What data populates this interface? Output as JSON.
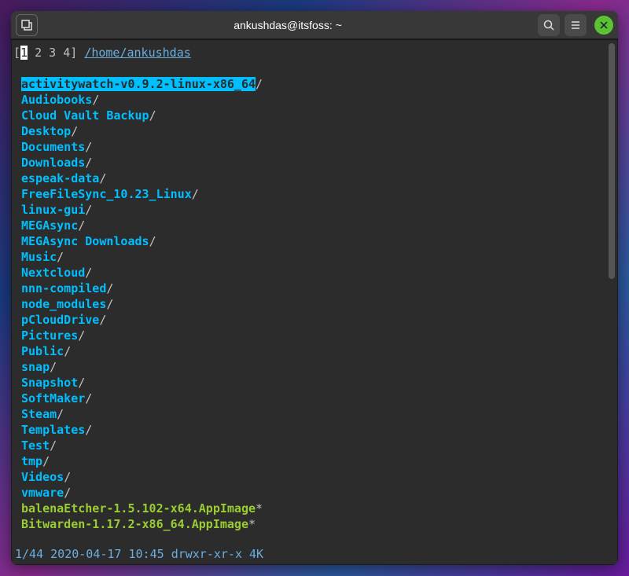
{
  "window": {
    "title": "ankushdas@itsfoss: ~"
  },
  "context": {
    "tabs": [
      "1",
      "2",
      "3",
      "4"
    ],
    "activeTab": "1",
    "path": "/home/ankushdas"
  },
  "entries": [
    {
      "name": "activitywatch-v0.9.2-linux-x86_64",
      "type": "dir",
      "selected": true
    },
    {
      "name": "Audiobooks",
      "type": "dir",
      "selected": false
    },
    {
      "name": "Cloud Vault Backup",
      "type": "dir",
      "selected": false
    },
    {
      "name": "Desktop",
      "type": "dir",
      "selected": false
    },
    {
      "name": "Documents",
      "type": "dir",
      "selected": false
    },
    {
      "name": "Downloads",
      "type": "dir",
      "selected": false
    },
    {
      "name": "espeak-data",
      "type": "dir",
      "selected": false
    },
    {
      "name": "FreeFileSync_10.23_Linux",
      "type": "dir",
      "selected": false
    },
    {
      "name": "linux-gui",
      "type": "dir",
      "selected": false
    },
    {
      "name": "MEGAsync",
      "type": "dir",
      "selected": false
    },
    {
      "name": "MEGAsync Downloads",
      "type": "dir",
      "selected": false
    },
    {
      "name": "Music",
      "type": "dir",
      "selected": false
    },
    {
      "name": "Nextcloud",
      "type": "dir",
      "selected": false
    },
    {
      "name": "nnn-compiled",
      "type": "dir",
      "selected": false
    },
    {
      "name": "node_modules",
      "type": "dir",
      "selected": false
    },
    {
      "name": "pCloudDrive",
      "type": "dir",
      "selected": false
    },
    {
      "name": "Pictures",
      "type": "dir",
      "selected": false
    },
    {
      "name": "Public",
      "type": "dir",
      "selected": false
    },
    {
      "name": "snap",
      "type": "dir",
      "selected": false
    },
    {
      "name": "Snapshot",
      "type": "dir",
      "selected": false
    },
    {
      "name": "SoftMaker",
      "type": "dir",
      "selected": false
    },
    {
      "name": "Steam",
      "type": "dir",
      "selected": false
    },
    {
      "name": "Templates",
      "type": "dir",
      "selected": false
    },
    {
      "name": "Test",
      "type": "dir",
      "selected": false
    },
    {
      "name": "tmp",
      "type": "dir",
      "selected": false
    },
    {
      "name": "Videos",
      "type": "dir",
      "selected": false
    },
    {
      "name": "vmware",
      "type": "dir",
      "selected": false
    },
    {
      "name": "balenaEtcher-1.5.102-x64.AppImage",
      "type": "exec",
      "selected": false
    },
    {
      "name": "Bitwarden-1.17.2-x86_64.AppImage",
      "type": "exec",
      "selected": false
    }
  ],
  "status": {
    "position": "1/44",
    "date": "2020-04-17",
    "time": "10:45",
    "perms": "drwxr-xr-x",
    "size": "4K"
  }
}
